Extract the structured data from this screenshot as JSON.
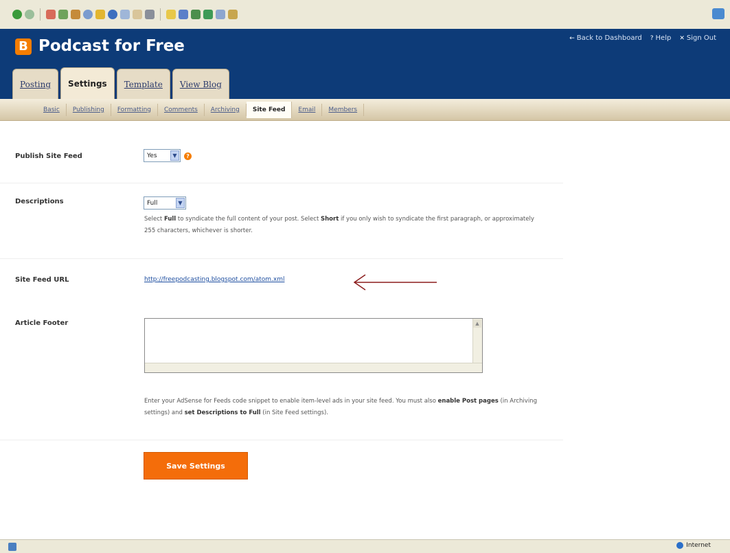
{
  "browser": {
    "toolbar_icons": [
      "back-icon",
      "forward-icon",
      "stop-icon",
      "refresh-icon",
      "home-icon",
      "search-icon",
      "favorites-icon",
      "media-icon",
      "history-icon",
      "mail-icon",
      "print-icon",
      "edit-icon",
      "messenger-icon",
      "research-icon",
      "extra-icon-1",
      "extra-icon-2",
      "extra-icon-3"
    ],
    "status_zone": "Internet"
  },
  "header": {
    "logo_letter": "B",
    "blog_title": "Podcast for Free",
    "links": {
      "dashboard": "Back to Dashboard",
      "help": "Help",
      "signout": "Sign Out"
    }
  },
  "tabs": [
    {
      "label": "Posting"
    },
    {
      "label": "Settings"
    },
    {
      "label": "Template"
    },
    {
      "label": "View Blog"
    }
  ],
  "subtabs": [
    {
      "label": "Basic"
    },
    {
      "label": "Publishing"
    },
    {
      "label": "Formatting"
    },
    {
      "label": "Comments"
    },
    {
      "label": "Archiving"
    },
    {
      "label": "Site Feed"
    },
    {
      "label": "Email"
    },
    {
      "label": "Members"
    }
  ],
  "form": {
    "publish_label": "Publish Site Feed",
    "publish_value": "Yes",
    "descriptions_label": "Descriptions",
    "descriptions_value": "Full",
    "descriptions_help_1": "Select ",
    "descriptions_help_full": "Full",
    "descriptions_help_2": " to syndicate the full content of your post. Select ",
    "descriptions_help_short": "Short",
    "descriptions_help_3": " if you only wish to syndicate the first paragraph, or approximately 255 characters, whichever is shorter.",
    "feed_url_label": "Site Feed URL",
    "feed_url": "http://freepodcasting.blogspot.com/atom.xml",
    "footer_label": "Article Footer",
    "footer_help_1": "Enter your AdSense for Feeds code snippet to enable item-level ads in your site feed. You must also ",
    "footer_help_enable": "enable Post pages",
    "footer_help_2": " (in Archiving settings) and ",
    "footer_help_desc": "set Descriptions to Full",
    "footer_help_3": " (in Site Feed settings).",
    "save_label": "Save Settings"
  }
}
